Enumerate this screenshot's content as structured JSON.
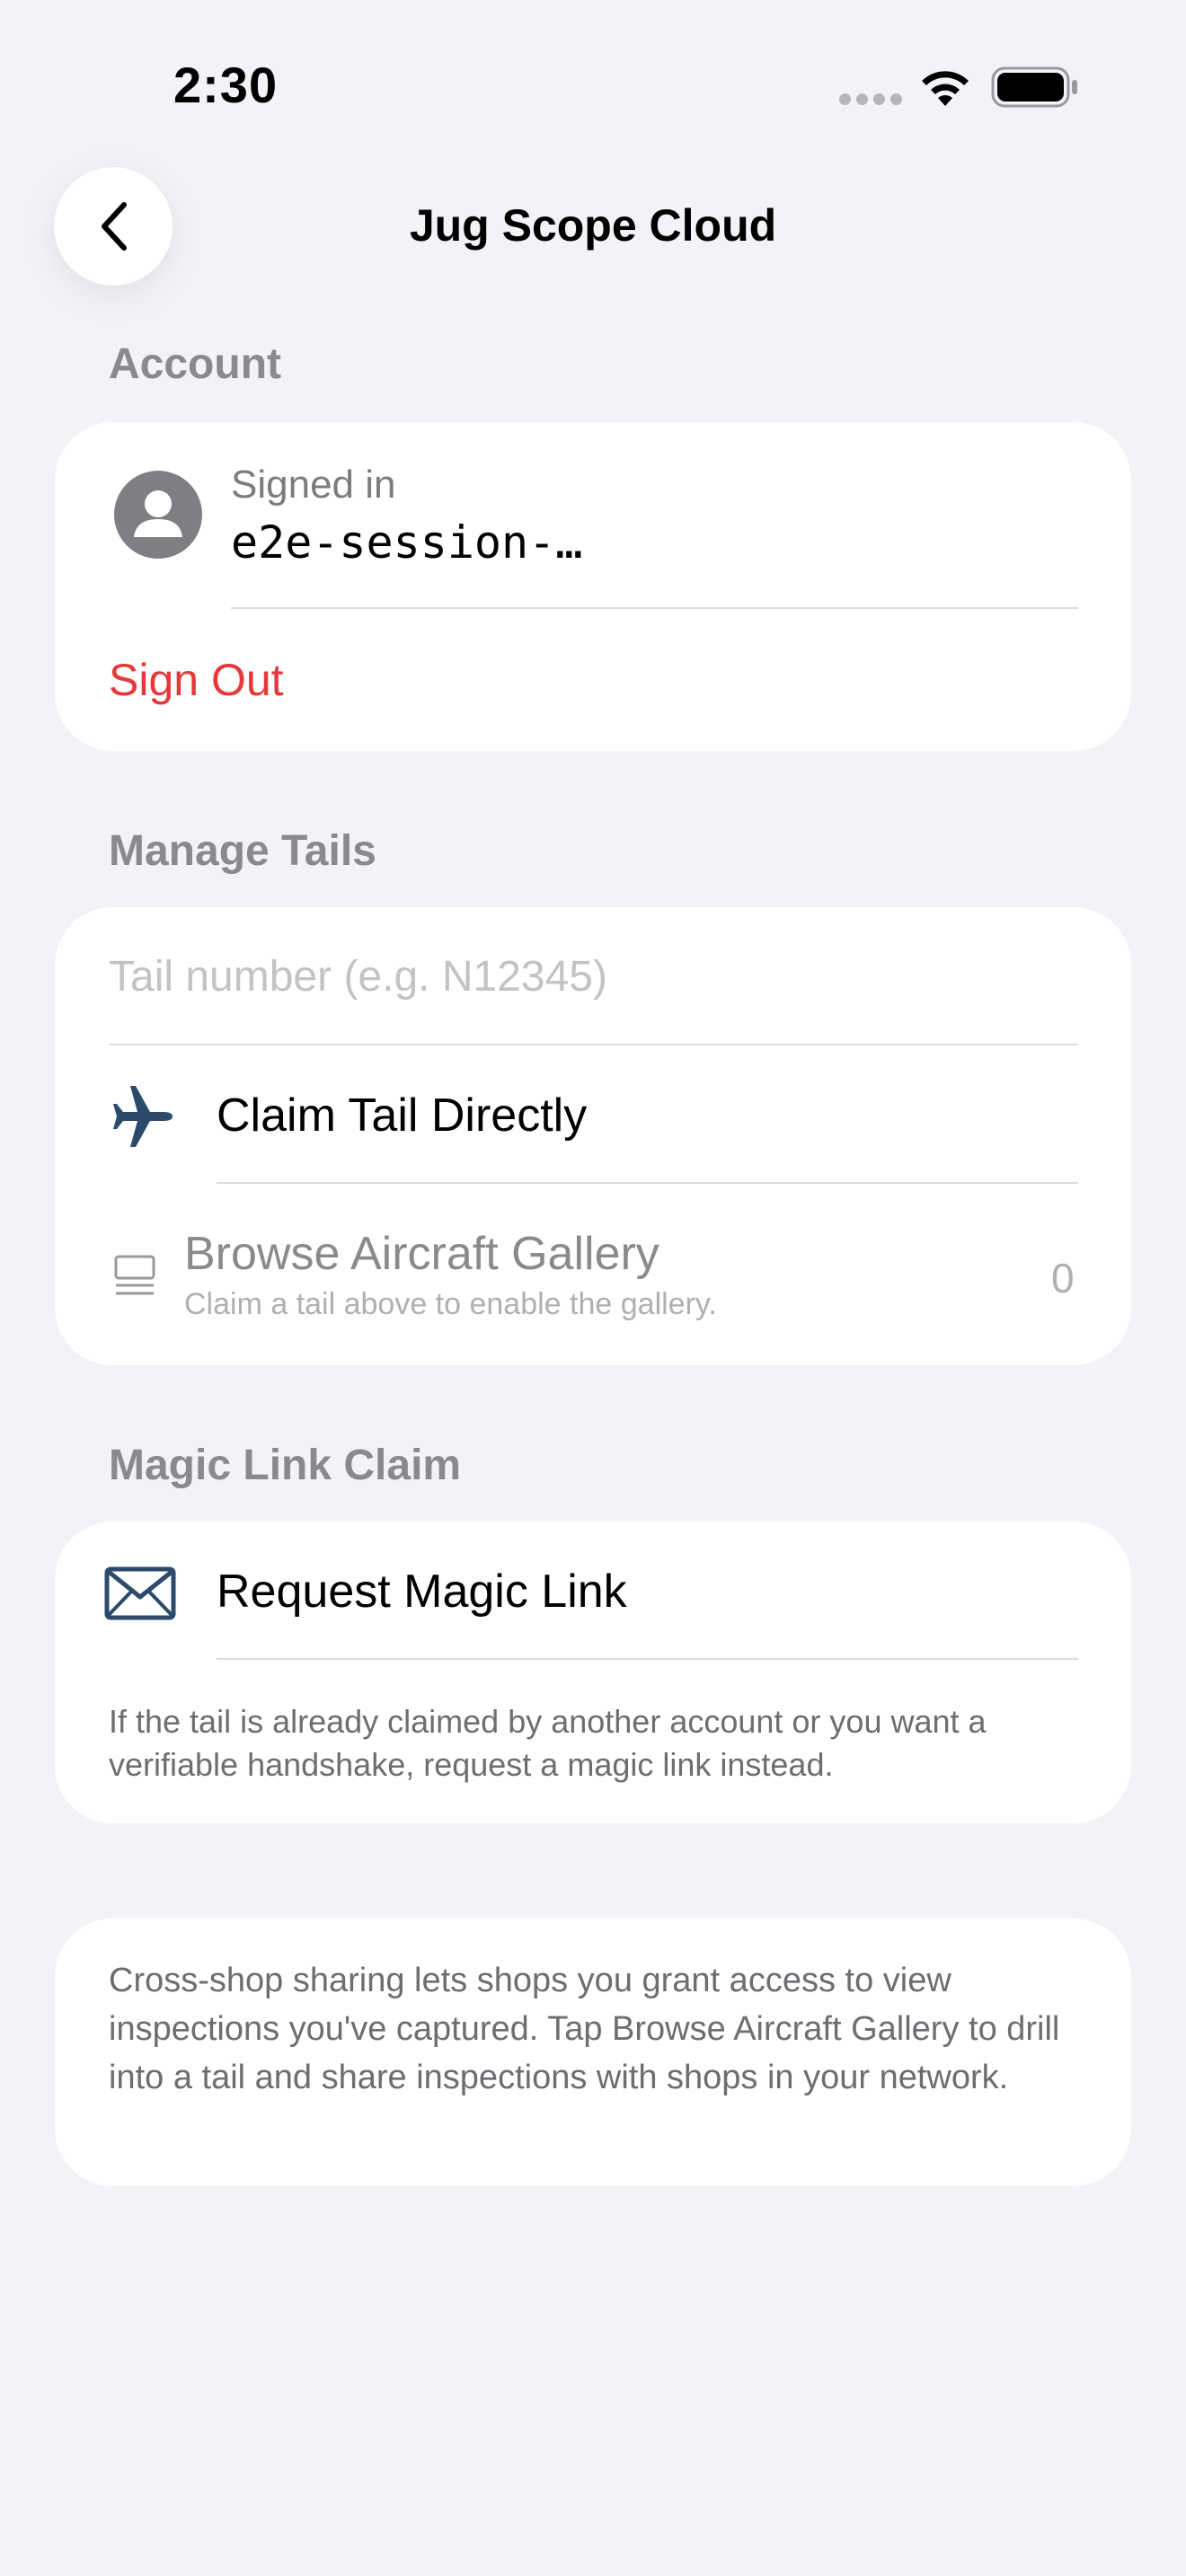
{
  "status_bar": {
    "time": "2:30"
  },
  "nav": {
    "back_icon": "chevron-left-icon",
    "title": "Jug Scope Cloud"
  },
  "account": {
    "section_title": "Account",
    "avatar_icon": "person-circle-icon",
    "signed_in_label": "Signed in",
    "session_value": "e2e-session-…",
    "sign_out_label": "Sign Out",
    "sign_out_color": "#e5383b"
  },
  "manage_tails": {
    "section_title": "Manage Tails",
    "tail_input_placeholder": "Tail number (e.g. N12345)",
    "tail_input_value": "",
    "claim_icon": "airplane-icon",
    "claim_label": "Claim Tail Directly",
    "gallery_icon": "gallery-list-icon",
    "gallery_label": "Browse Aircraft Gallery",
    "gallery_subtitle": "Claim a tail above to enable the gallery.",
    "gallery_count": "0"
  },
  "magic_link": {
    "section_title": "Magic Link Claim",
    "request_icon": "envelope-icon",
    "request_label": "Request Magic Link",
    "note": "If the tail is already claimed by another account or you want a verifiable handshake, request a magic link instead."
  },
  "info_card": {
    "text": "Cross-shop sharing lets shops you grant access to view inspections you've captured. Tap Browse Aircraft Gallery to drill into a tail and share inspections with shops in your network."
  },
  "colors": {
    "background": "#f2f2f7",
    "accent_icon": "#2c4a6b",
    "destructive": "#e5383b"
  }
}
